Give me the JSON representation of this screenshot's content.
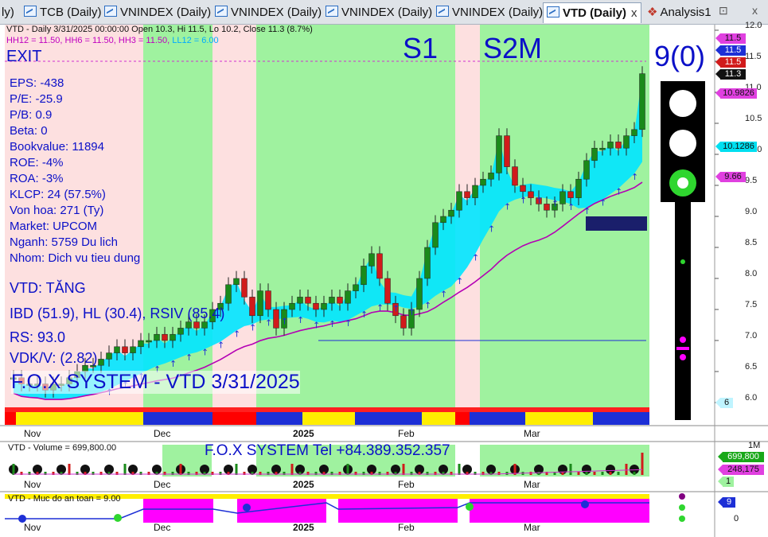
{
  "tabs": [
    {
      "label": "ly)"
    },
    {
      "label": "TCB (Daily)"
    },
    {
      "label": "VNINDEX (Daily)"
    },
    {
      "label": "VNINDEX (Daily)"
    },
    {
      "label": "VNINDEX (Daily)"
    },
    {
      "label": "VNINDEX (Daily)"
    },
    {
      "label": "VTD (Daily)"
    },
    {
      "label": "Analysis1"
    }
  ],
  "active_tab_close": "x",
  "tab_controls": {
    "pin": "⊡",
    "close": "x"
  },
  "header_line1": "VTD - Daily 3/31/2025 00:00:00 Open 10.3, Hi 11.5, Lo 10.2, Close 11.3 (8.7%)",
  "header_line2": {
    "hh12": "HH12 = 11.50,",
    "hh6": "HH6 = 11.50,",
    "hh3": "HH3 = 11.50,",
    "ll12": "LL12 = 6.00"
  },
  "signal": "EXIT",
  "fundamentals": [
    "EPS: -438",
    "P/E: -25.9",
    "P/B: 0.9",
    "Beta: 0",
    "Bookvalue: 11894",
    "ROE: -4%",
    "ROA: -3%",
    "KLCP: 24 (57.5%)",
    "Von hoa: 271 (Ty)",
    "Market: UPCOM",
    "Nganh: 5759 Du lich",
    "Nhom: Dich vu tieu dung"
  ],
  "trend": "VTD: TĂNG",
  "ibd_line": "IBD (51.9), HL (30.4), RSIV (85.4)",
  "rs_line": "RS: 93.0",
  "vdk_line": "VDK/V:  (2.82)",
  "system_title": "F.O.X SYSTEM - VTD 3/31/2025",
  "stage_labels": {
    "s1": "S1",
    "s2m": "S2M"
  },
  "score": "9(0)",
  "price_labels": {
    "hh12": "11.5",
    "hh6": "11.5",
    "hh3": "11.5",
    "close": "11.3",
    "ma1": "10.9826",
    "ma2": "10.1286",
    "ma3": "9.66",
    "count": "6"
  },
  "price_axis": [
    "12.0",
    "11.5",
    "11.0",
    "10.5",
    "10.0",
    "9.5",
    "9.0",
    "8.5",
    "8.0",
    "7.5",
    "7.0",
    "6.5",
    "6.0"
  ],
  "months": [
    "Nov",
    "Dec",
    "2025",
    "Feb",
    "Mar"
  ],
  "volume_title": "VTD - Volume = 699,800.00",
  "contact": "F.O.X SYSTEM Tel +84.389.352.357",
  "volume_labels": {
    "vol": "699,800",
    "avg": "248,175",
    "one": "1"
  },
  "volume_axis": "1M",
  "safety_title": "VTD - Muc do an toan = 9.00",
  "safety_labels": {
    "val": "9",
    "zero": "0"
  },
  "colors": {
    "accent": "#0b10c8",
    "green_zone": "#9ff29f",
    "pink_zone": "#fde0e0",
    "magenta": "#ff00ff",
    "cyan": "#00e5ff"
  },
  "chart_data": {
    "type": "candlestick",
    "last_bar": {
      "date": "3/31/2025",
      "open": 10.3,
      "high": 11.5,
      "low": 10.2,
      "close": 11.3,
      "change_pct": 8.7
    },
    "ylim": [
      6.0,
      12.0
    ],
    "x_ticks": [
      "Nov",
      "Dec",
      "2025",
      "Feb",
      "Mar"
    ],
    "close_series": [
      6.4,
      6.3,
      6.3,
      6.3,
      6.2,
      6.3,
      6.3,
      6.4,
      6.5,
      6.6,
      6.6,
      6.7,
      6.8,
      6.9,
      6.8,
      6.9,
      7.0,
      7.0,
      7.1,
      7.0,
      7.1,
      7.2,
      7.3,
      7.2,
      7.3,
      7.5,
      7.6,
      7.9,
      8.0,
      7.7,
      7.4,
      7.8,
      7.5,
      7.2,
      7.5,
      7.6,
      7.7,
      7.6,
      7.5,
      7.6,
      7.7,
      7.6,
      7.8,
      7.9,
      8.2,
      8.4,
      8.0,
      7.6,
      7.4,
      7.2,
      7.5,
      8.0,
      8.5,
      8.9,
      9.0,
      9.1,
      9.4,
      9.3,
      9.5,
      9.6,
      9.7,
      10.3,
      9.8,
      9.5,
      9.4,
      9.3,
      9.2,
      9.1,
      9.2,
      9.4,
      9.3,
      9.6,
      9.9,
      10.1,
      10.1,
      10.2,
      10.1,
      10.3,
      10.4,
      11.3
    ]
  }
}
